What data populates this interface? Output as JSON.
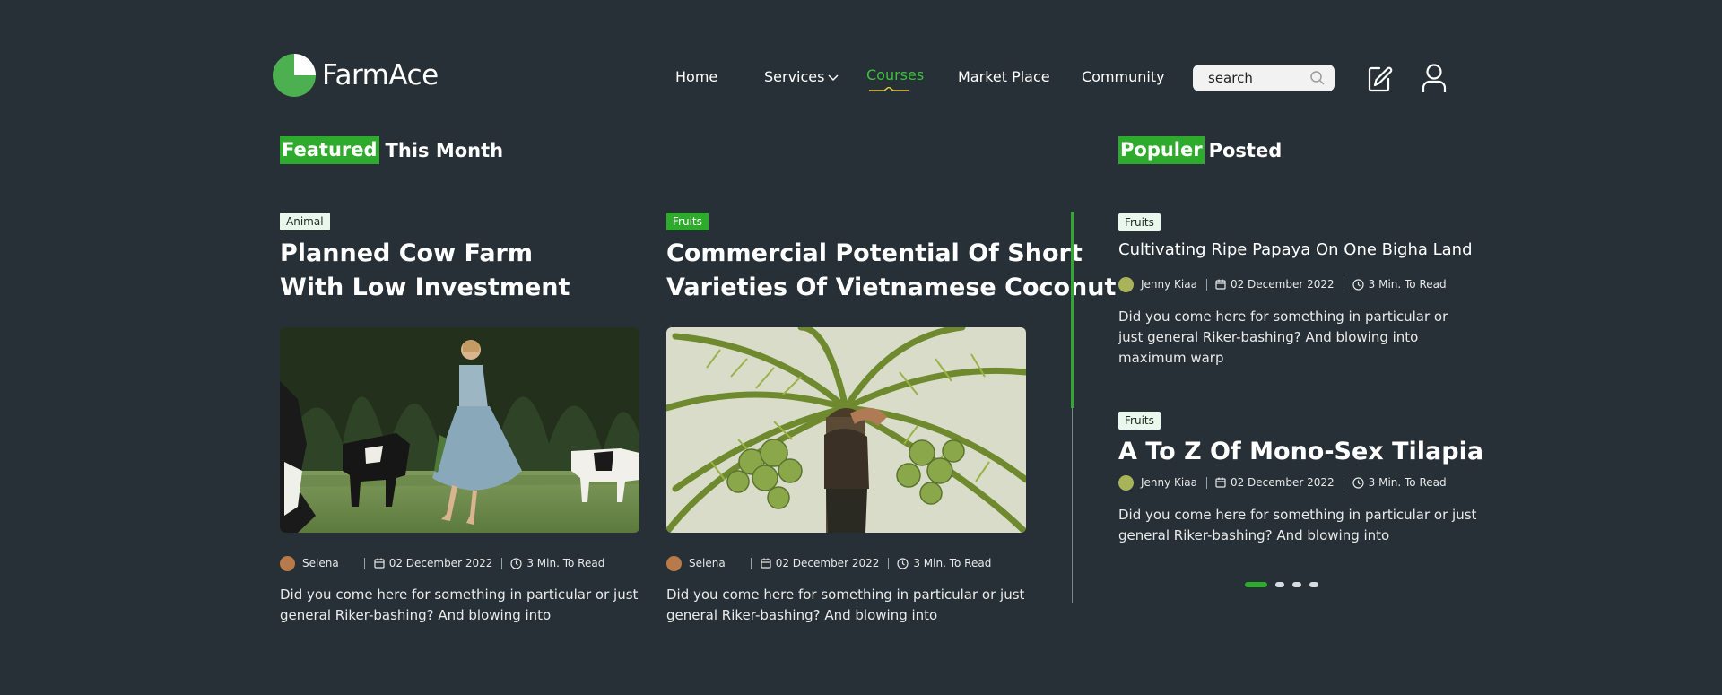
{
  "brand": {
    "name": "FarmAce",
    "accent": "#2eaa2c"
  },
  "nav": {
    "items": [
      {
        "label": "Home"
      },
      {
        "label": "Services"
      },
      {
        "label": "Courses"
      },
      {
        "label": "Market Place"
      },
      {
        "label": "Community"
      }
    ],
    "active": "Courses"
  },
  "search": {
    "placeholder": "search"
  },
  "icons": {
    "edit": "edit-icon",
    "user": "user-icon",
    "search": "search-icon"
  },
  "featured": {
    "title_highlight": "Featured",
    "title_rest": "This Month",
    "cards": [
      {
        "category": "Animal",
        "title_line1": "Planned Cow Farm",
        "title_line2": "With Low Investment",
        "author": "Selena",
        "date": "02 December 2022",
        "read": "3 Min. To Read",
        "desc_line1": "Did you come here for something in particular or just",
        "desc_line2": "general Riker-bashing? And blowing into"
      },
      {
        "category": "Fruits",
        "title_line1": "Commercial Potential Of Short",
        "title_line2": "Varieties Of Vietnamese Coconut",
        "author": "Selena",
        "date": "02 December 2022",
        "read": "3 Min. To Read",
        "desc_line1": "Did you come here for something in particular or just",
        "desc_line2": "general Riker-bashing? And blowing into"
      }
    ]
  },
  "popular": {
    "title_highlight": "Populer",
    "title_rest": "Posted",
    "posts": [
      {
        "category": "Fruits",
        "title": "Cultivating Ripe Papaya On One Bigha Land",
        "author": "Jenny Kiaa",
        "date": "02 December 2022",
        "read": "3 Min. To Read",
        "desc_line1": "Did you come here for something in particular or",
        "desc_line2": "just general Riker-bashing? And blowing into",
        "desc_line3": "maximum warp"
      },
      {
        "category": "Fruits",
        "title": "A To Z Of Mono-Sex Tilapia",
        "author": "Jenny Kiaa",
        "date": "02 December 2022",
        "read": "3 Min. To Read",
        "desc_line1": "Did you come here for something in particular or just",
        "desc_line2": "general Riker-bashing? And blowing into"
      }
    ]
  },
  "pagination": {
    "pages": 4,
    "current": 1
  }
}
